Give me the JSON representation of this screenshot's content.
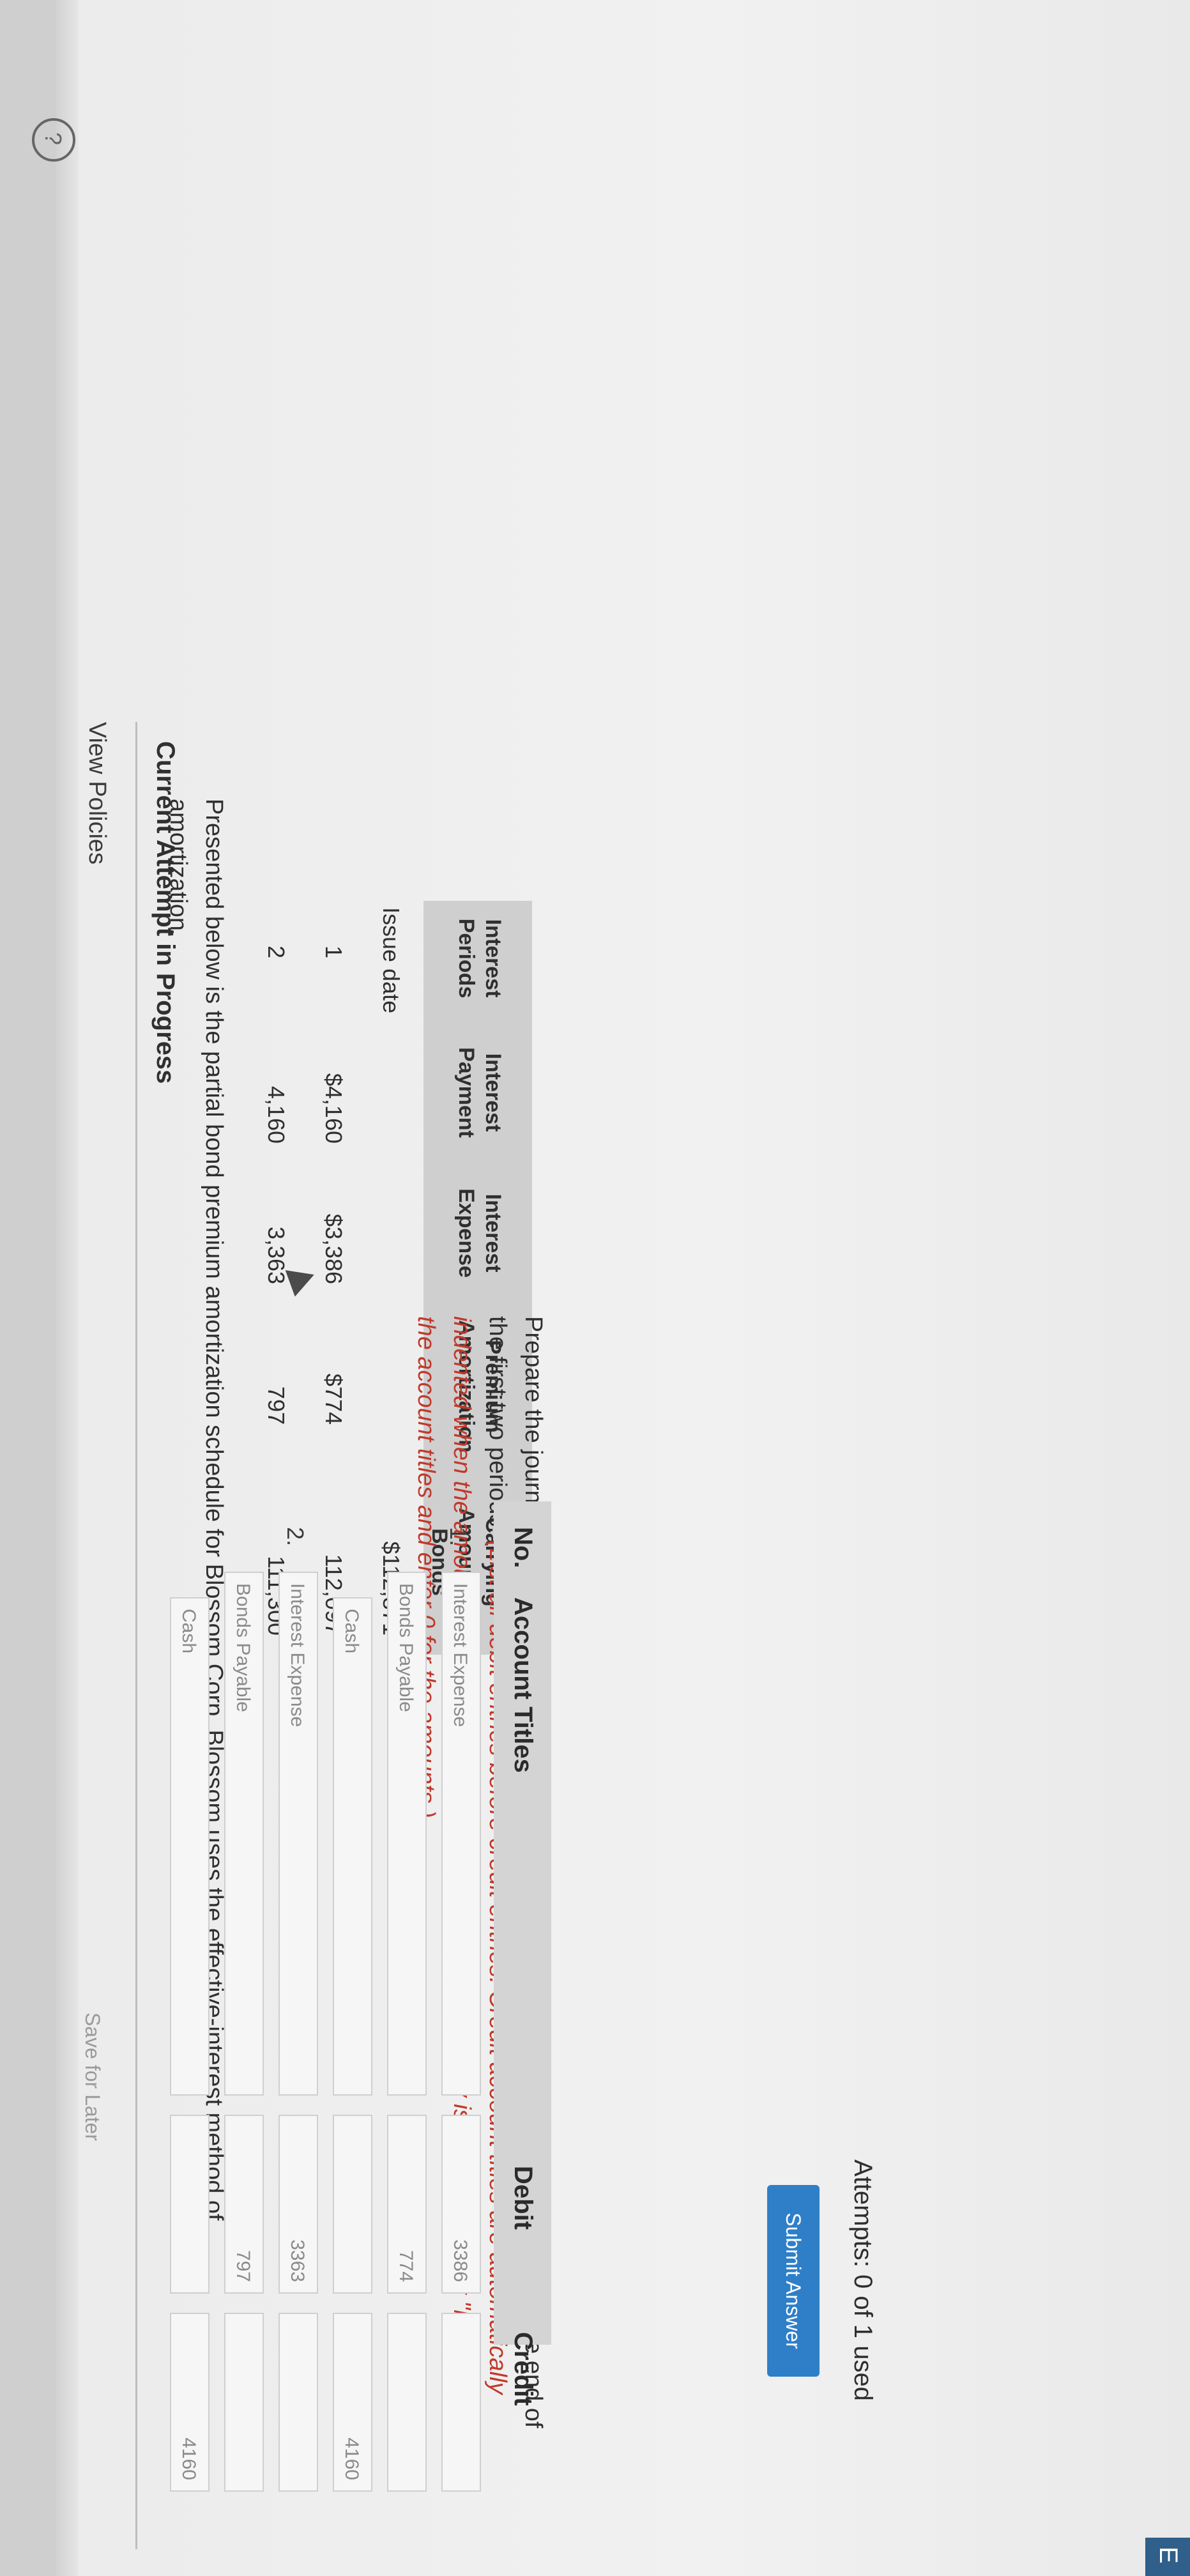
{
  "header": {
    "view_policies": "View Policies"
  },
  "attempt": {
    "heading": "Current Attempt in Progress"
  },
  "intro": "Presented below is the partial bond premium amortization schedule for Blossom Corp. Blossom uses the effective-interest method of amortization.",
  "schedule": {
    "headers": [
      "Interest Periods",
      "Interest Payment",
      "Interest Expense",
      "Premium Amortization",
      "Carrying Amount of Bonds"
    ],
    "rows": [
      {
        "period": "Issue date",
        "payment": "",
        "expense": "",
        "amortization": "",
        "carrying": "$112,871"
      },
      {
        "period": "1",
        "payment": "$4,160",
        "expense": "$3,386",
        "amortization": "$774",
        "carrying": "112,097"
      },
      {
        "period": "2",
        "payment": "4,160",
        "expense": "3,363",
        "amortization": "797",
        "carrying": "111,300"
      }
    ]
  },
  "instructions": {
    "plain": "Prepare the journal entries to record the payment of interest and the premium amortization at the end of the first two periods.",
    "red": "(List all debit entries before credit entries. Credit account titles are automatically indented when the amount is entered. Do not indent manually. If no entry is required, select \"No Entry\" for the account titles and enter 0 for the amounts.)"
  },
  "journal": {
    "headers": {
      "no": "No.",
      "titles": "Account Titles",
      "debit": "Debit",
      "credit": "Credit"
    },
    "rows": [
      {
        "no": "1.",
        "title": "Interest Expense",
        "debit": "3386",
        "credit": ""
      },
      {
        "no": "",
        "title": "Bonds Payable",
        "debit": "774",
        "credit": ""
      },
      {
        "no": "",
        "title": "Cash",
        "debit": "",
        "credit": "4160"
      },
      {
        "no": "2.",
        "title": "Interest Expense",
        "debit": "3363",
        "credit": ""
      },
      {
        "no": "",
        "title": "Bonds Payable",
        "debit": "797",
        "credit": ""
      },
      {
        "no": "",
        "title": "Cash",
        "debit": "",
        "credit": "4160"
      }
    ]
  },
  "footer": {
    "save_later": "Save for Later",
    "attempts": "Attempts: 0 of 1 used",
    "submit": "Submit Answer"
  },
  "icons": {
    "help": "help-circle-icon",
    "corner": "app-badge-icon",
    "cursor": "mouse-pointer-icon"
  },
  "colors": {
    "accent": "#2f7fc8",
    "instruction_red": "#c0392b",
    "header_gray": "#cfcfcf"
  }
}
